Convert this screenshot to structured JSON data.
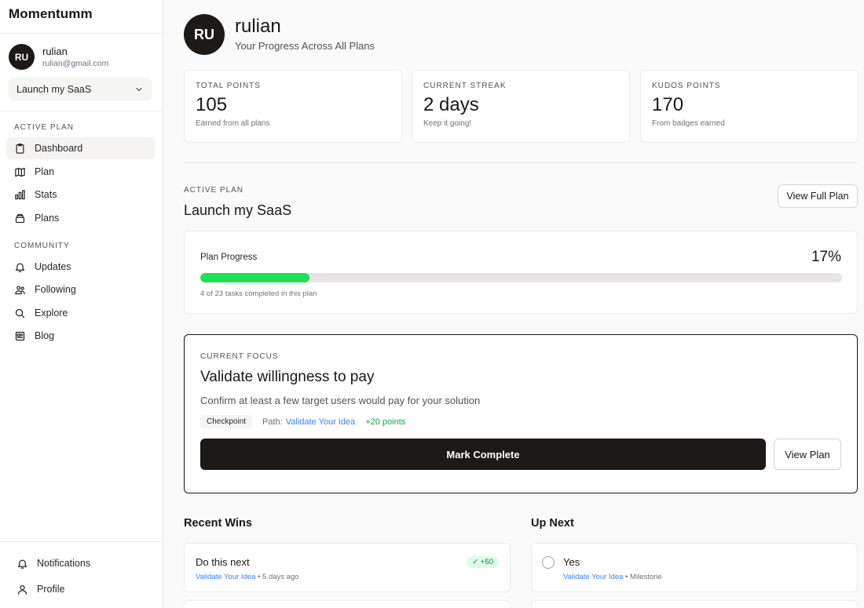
{
  "sidebar": {
    "brand": "Momentumm",
    "user": {
      "initials": "RU",
      "name": "rulian",
      "email": "rulian@gmail.com"
    },
    "plan_select": {
      "value": "Launch my SaaS"
    },
    "active_plan_label": "ACTIVE PLAN",
    "active_nav": [
      {
        "label": "Dashboard",
        "icon": "clipboard-icon",
        "active": true
      },
      {
        "label": "Plan",
        "icon": "map-icon",
        "active": false
      },
      {
        "label": "Stats",
        "icon": "bar-chart-icon",
        "active": false
      },
      {
        "label": "Plans",
        "icon": "stack-icon",
        "active": false
      }
    ],
    "community_label": "COMMUNITY",
    "community_nav": [
      {
        "label": "Updates",
        "icon": "bell-icon"
      },
      {
        "label": "Following",
        "icon": "users-icon"
      },
      {
        "label": "Explore",
        "icon": "search-icon"
      },
      {
        "label": "Blog",
        "icon": "newspaper-icon"
      }
    ],
    "bottom_nav": [
      {
        "label": "Notifications",
        "icon": "bell-icon"
      },
      {
        "label": "Profile",
        "icon": "user-icon"
      }
    ]
  },
  "header": {
    "initials": "RU",
    "name": "rulian",
    "subtitle": "Your Progress Across All Plans"
  },
  "stats": [
    {
      "label": "TOTAL POINTS",
      "value": "105",
      "hint": "Earned from all plans"
    },
    {
      "label": "CURRENT STREAK",
      "value": "2 days",
      "hint": "Keep it going!"
    },
    {
      "label": "KUDOS POINTS",
      "value": "170",
      "hint": "From badges earned"
    }
  ],
  "active_plan": {
    "label": "ACTIVE PLAN",
    "title": "Launch my SaaS",
    "view_full_plan": "View Full Plan",
    "progress": {
      "label": "Plan Progress",
      "percent_text": "17%",
      "fraction": 0.17,
      "hint": "4 of 23 tasks completed in this plan"
    }
  },
  "focus": {
    "label": "CURRENT FOCUS",
    "title": "Validate willingness to pay",
    "description": "Confirm at least a few target users would pay for your solution",
    "chip": "Checkpoint",
    "path_prefix": "Path:",
    "path_link": "Validate Your Idea",
    "points": "+20 points",
    "complete_button": "Mark Complete",
    "view_plan_button": "View Plan"
  },
  "recent_wins": {
    "title": "Recent Wins",
    "items": [
      {
        "title": "Do this next",
        "path": "Validate Your Idea",
        "sep": " • ",
        "time": "5 days ago",
        "badge": "✓ +50"
      }
    ]
  },
  "up_next": {
    "title": "Up Next",
    "items": [
      {
        "title": "Yes",
        "path": "Validate Your Idea",
        "sep": " • ",
        "type": "Milestone"
      }
    ]
  },
  "colors": {
    "accent_green": "#22dd55",
    "link_blue": "#3b82f6",
    "points_green": "#16a34a",
    "dark": "#1c1917"
  }
}
